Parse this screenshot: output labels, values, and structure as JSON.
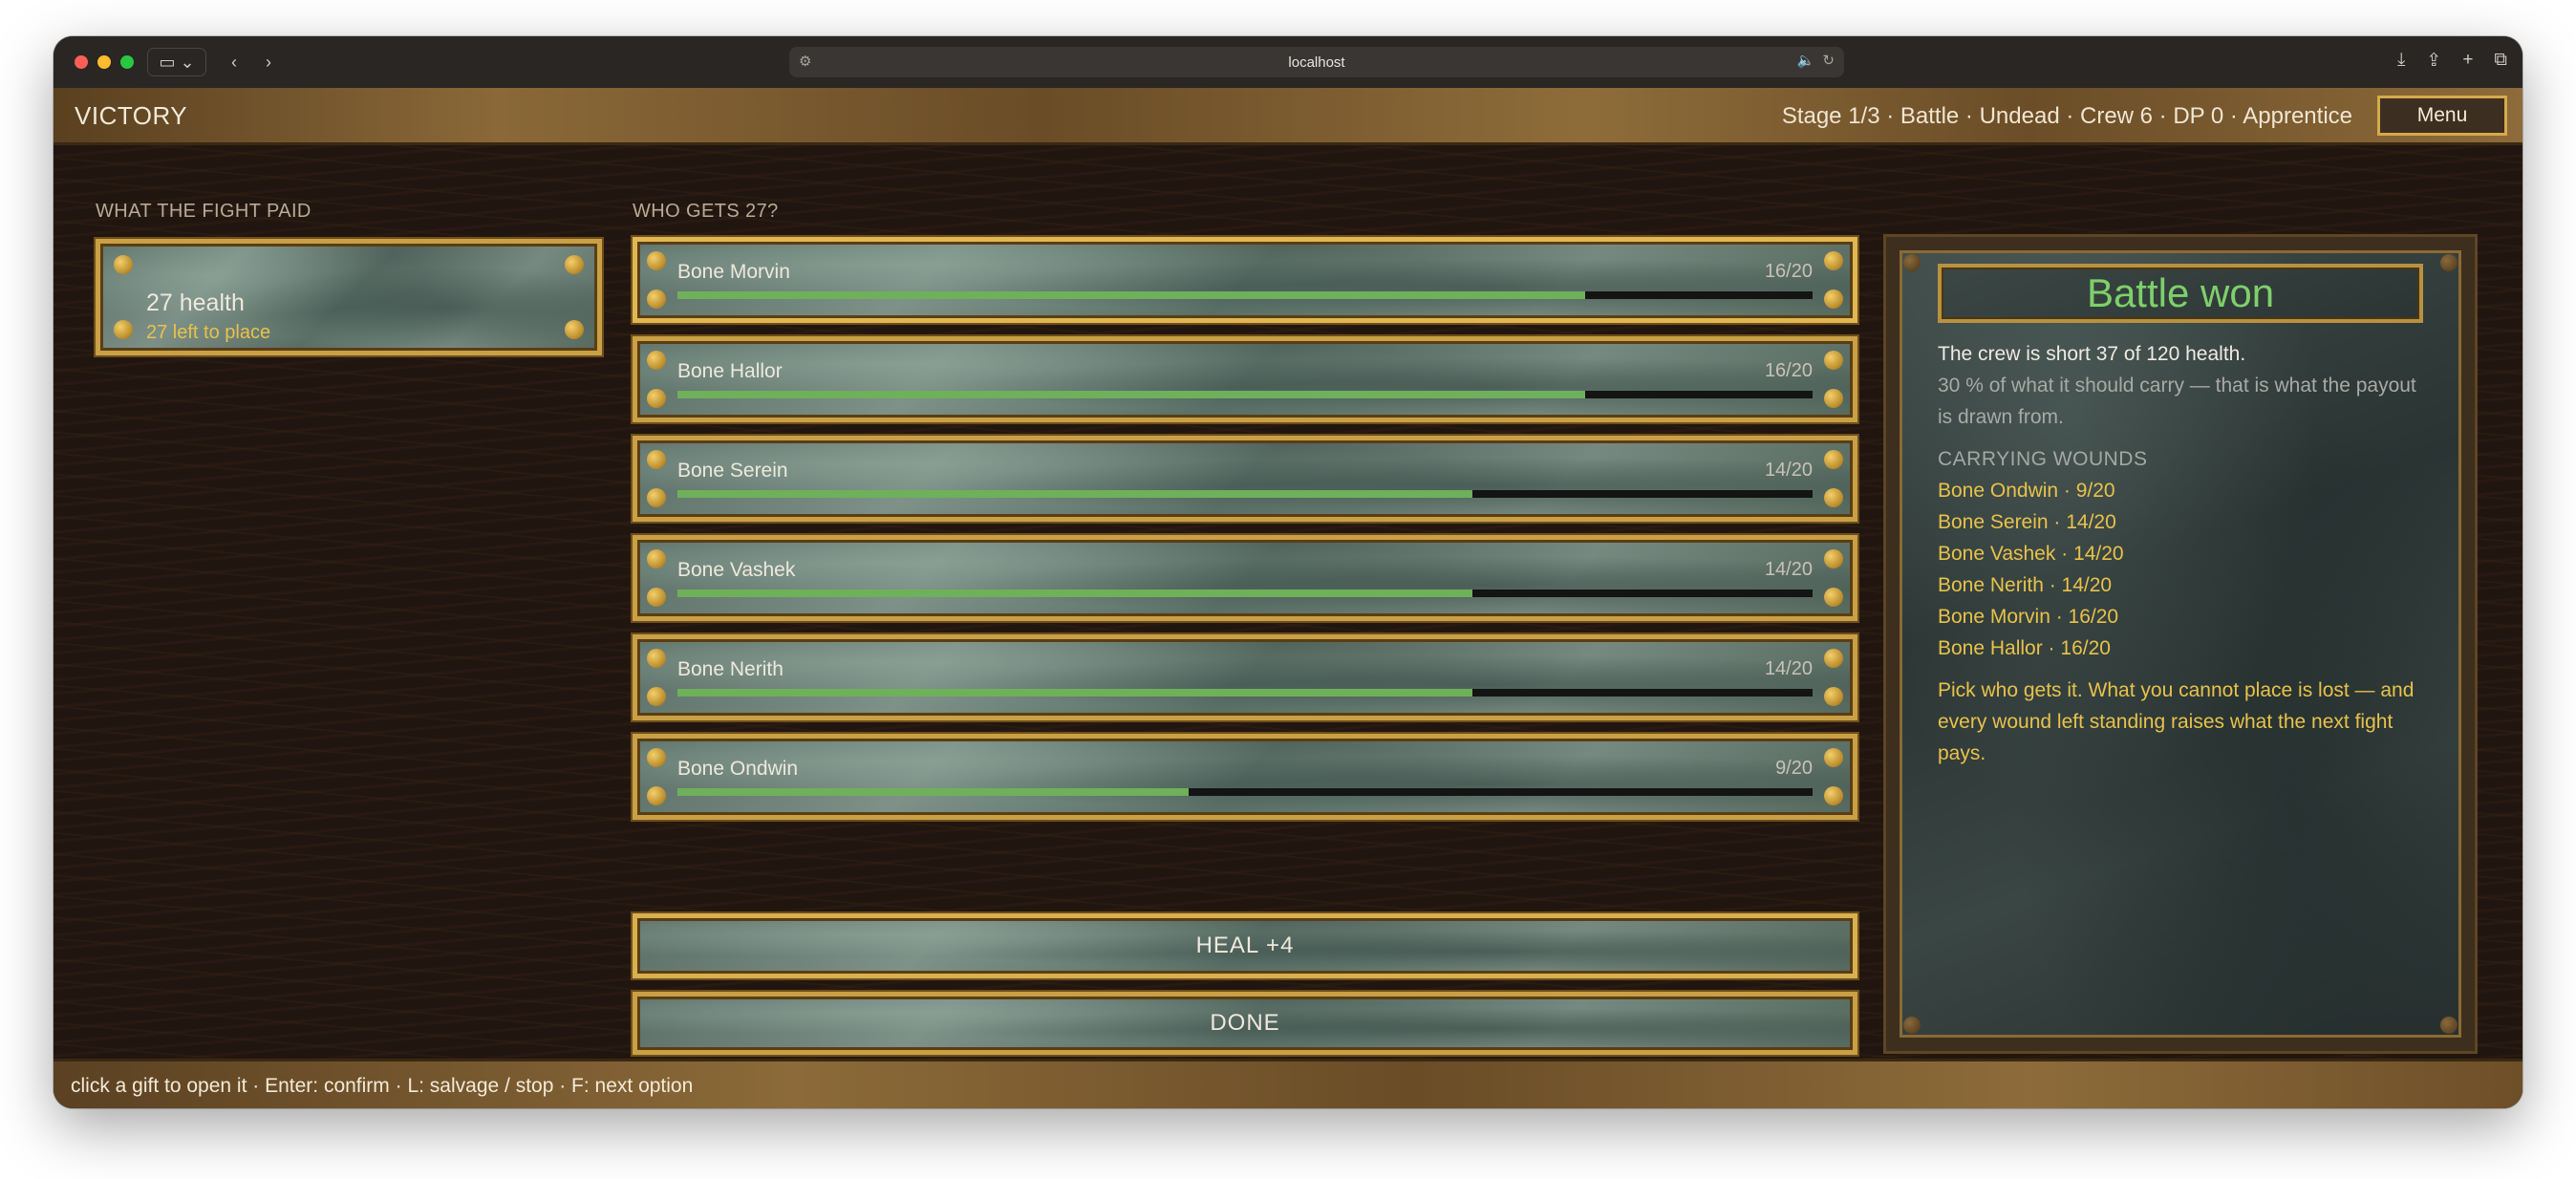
{
  "browser": {
    "url": "localhost"
  },
  "header": {
    "title": "VICTORY",
    "status": "Stage 1/3 · Battle · Undead · Crew 6 · DP 0 · Apprentice",
    "menu_label": "Menu"
  },
  "reward": {
    "section_label": "WHAT THE FIGHT PAID",
    "amount": "27 health",
    "remaining": "27 left to place"
  },
  "crew": {
    "section_label": "WHO GETS 27?",
    "members": [
      {
        "name": "Bone Morvin",
        "hp_text": "16/20",
        "hp": 16,
        "max": 20
      },
      {
        "name": "Bone Hallor",
        "hp_text": "16/20",
        "hp": 16,
        "max": 20
      },
      {
        "name": "Bone Serein",
        "hp_text": "14/20",
        "hp": 14,
        "max": 20
      },
      {
        "name": "Bone Vashek",
        "hp_text": "14/20",
        "hp": 14,
        "max": 20
      },
      {
        "name": "Bone Nerith",
        "hp_text": "14/20",
        "hp": 14,
        "max": 20
      },
      {
        "name": "Bone Ondwin",
        "hp_text": "9/20",
        "hp": 9,
        "max": 20
      }
    ]
  },
  "actions": {
    "heal_label": "HEAL  +4",
    "done_label": "DONE"
  },
  "panel": {
    "title": "Battle won",
    "line1": "The crew is short 37 of 120 health.",
    "line2": "30 % of what it should carry — that is what the payout is drawn from.",
    "wounds_heading": "CARRYING WOUNDS",
    "wounds": [
      "Bone Ondwin  ·  9/20",
      "Bone Serein  ·  14/20",
      "Bone Vashek  ·  14/20",
      "Bone Nerith  ·  14/20",
      "Bone Morvin  ·  16/20",
      "Bone Hallor  ·  16/20"
    ],
    "instruction": "Pick who gets it. What you cannot place is lost — and every wound left standing raises what the next fight pays."
  },
  "footer": {
    "hint": "click a gift to open it · Enter: confirm · L: salvage / stop · F: next option"
  },
  "colors": {
    "gold": "#c9a045",
    "hp_green": "#6fb05a",
    "title_green": "#7ed06a",
    "highlight_gold": "#e8c24a"
  }
}
